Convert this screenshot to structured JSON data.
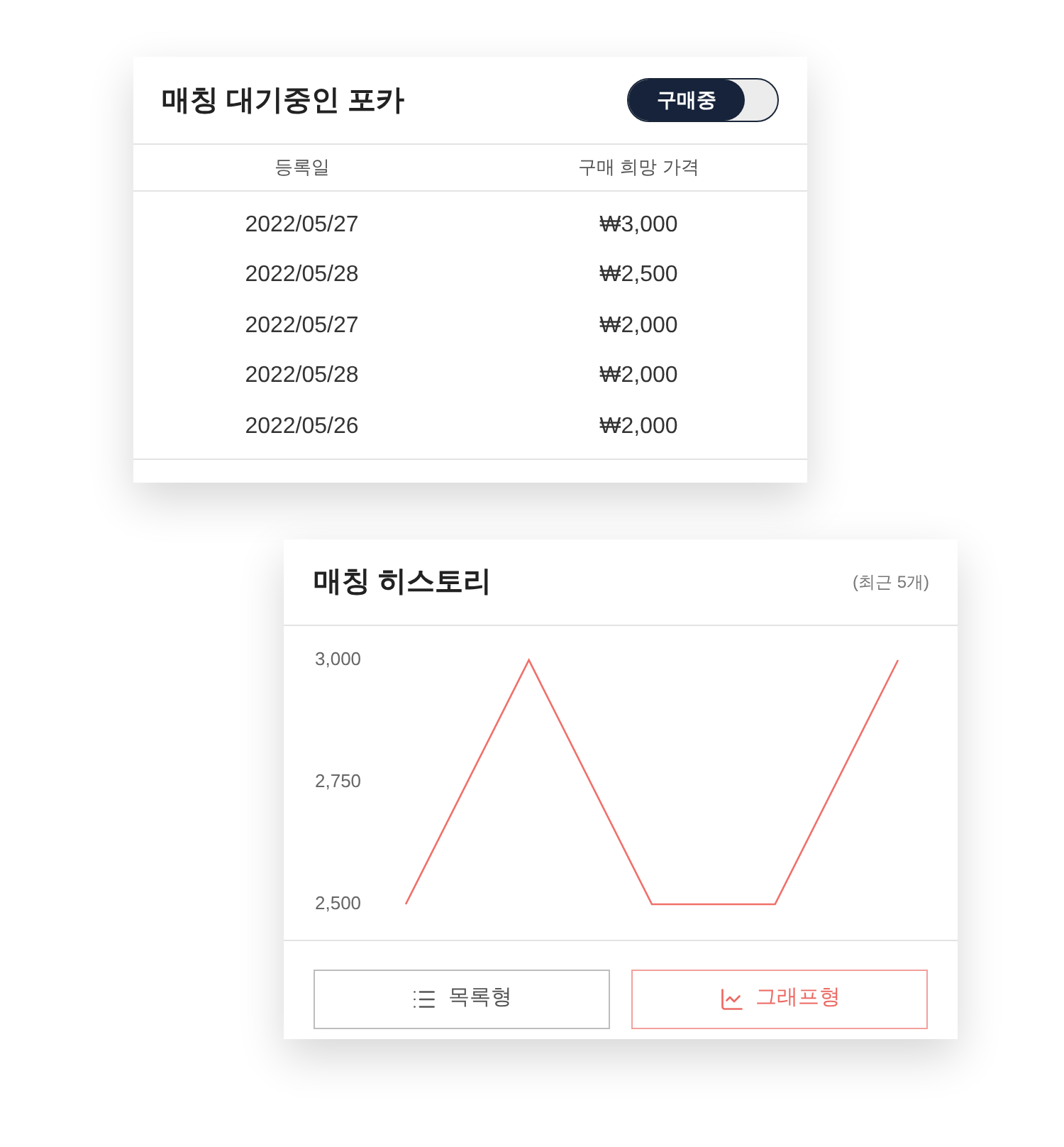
{
  "waiting_card": {
    "title": "매칭 대기중인 포카",
    "toggle": {
      "label": "구매중",
      "on": true
    },
    "table": {
      "columns": [
        "등록일",
        "구매 희망 가격"
      ],
      "rows": [
        [
          "2022/05/27",
          "₩3,000"
        ],
        [
          "2022/05/28",
          "₩2,500"
        ],
        [
          "2022/05/27",
          "₩2,000"
        ],
        [
          "2022/05/28",
          "₩2,000"
        ],
        [
          "2022/05/26",
          "₩2,000"
        ]
      ]
    }
  },
  "history_card": {
    "title": "매칭 히스토리",
    "note": "(최근 5개)",
    "chart_data": {
      "type": "line",
      "ylim": [
        2500,
        3000
      ],
      "yticks": [
        {
          "value": 3000,
          "label": "3,000"
        },
        {
          "value": 2750,
          "label": "2,750"
        },
        {
          "value": 2500,
          "label": "2,500"
        }
      ],
      "series": [
        {
          "color": "#f0706a",
          "values": [
            2500,
            3000,
            2500,
            2500,
            3000
          ]
        }
      ]
    },
    "view_buttons": [
      {
        "kind": "list",
        "label": "목록형",
        "selected": false
      },
      {
        "kind": "graph",
        "label": "그래프형",
        "selected": true
      }
    ]
  }
}
